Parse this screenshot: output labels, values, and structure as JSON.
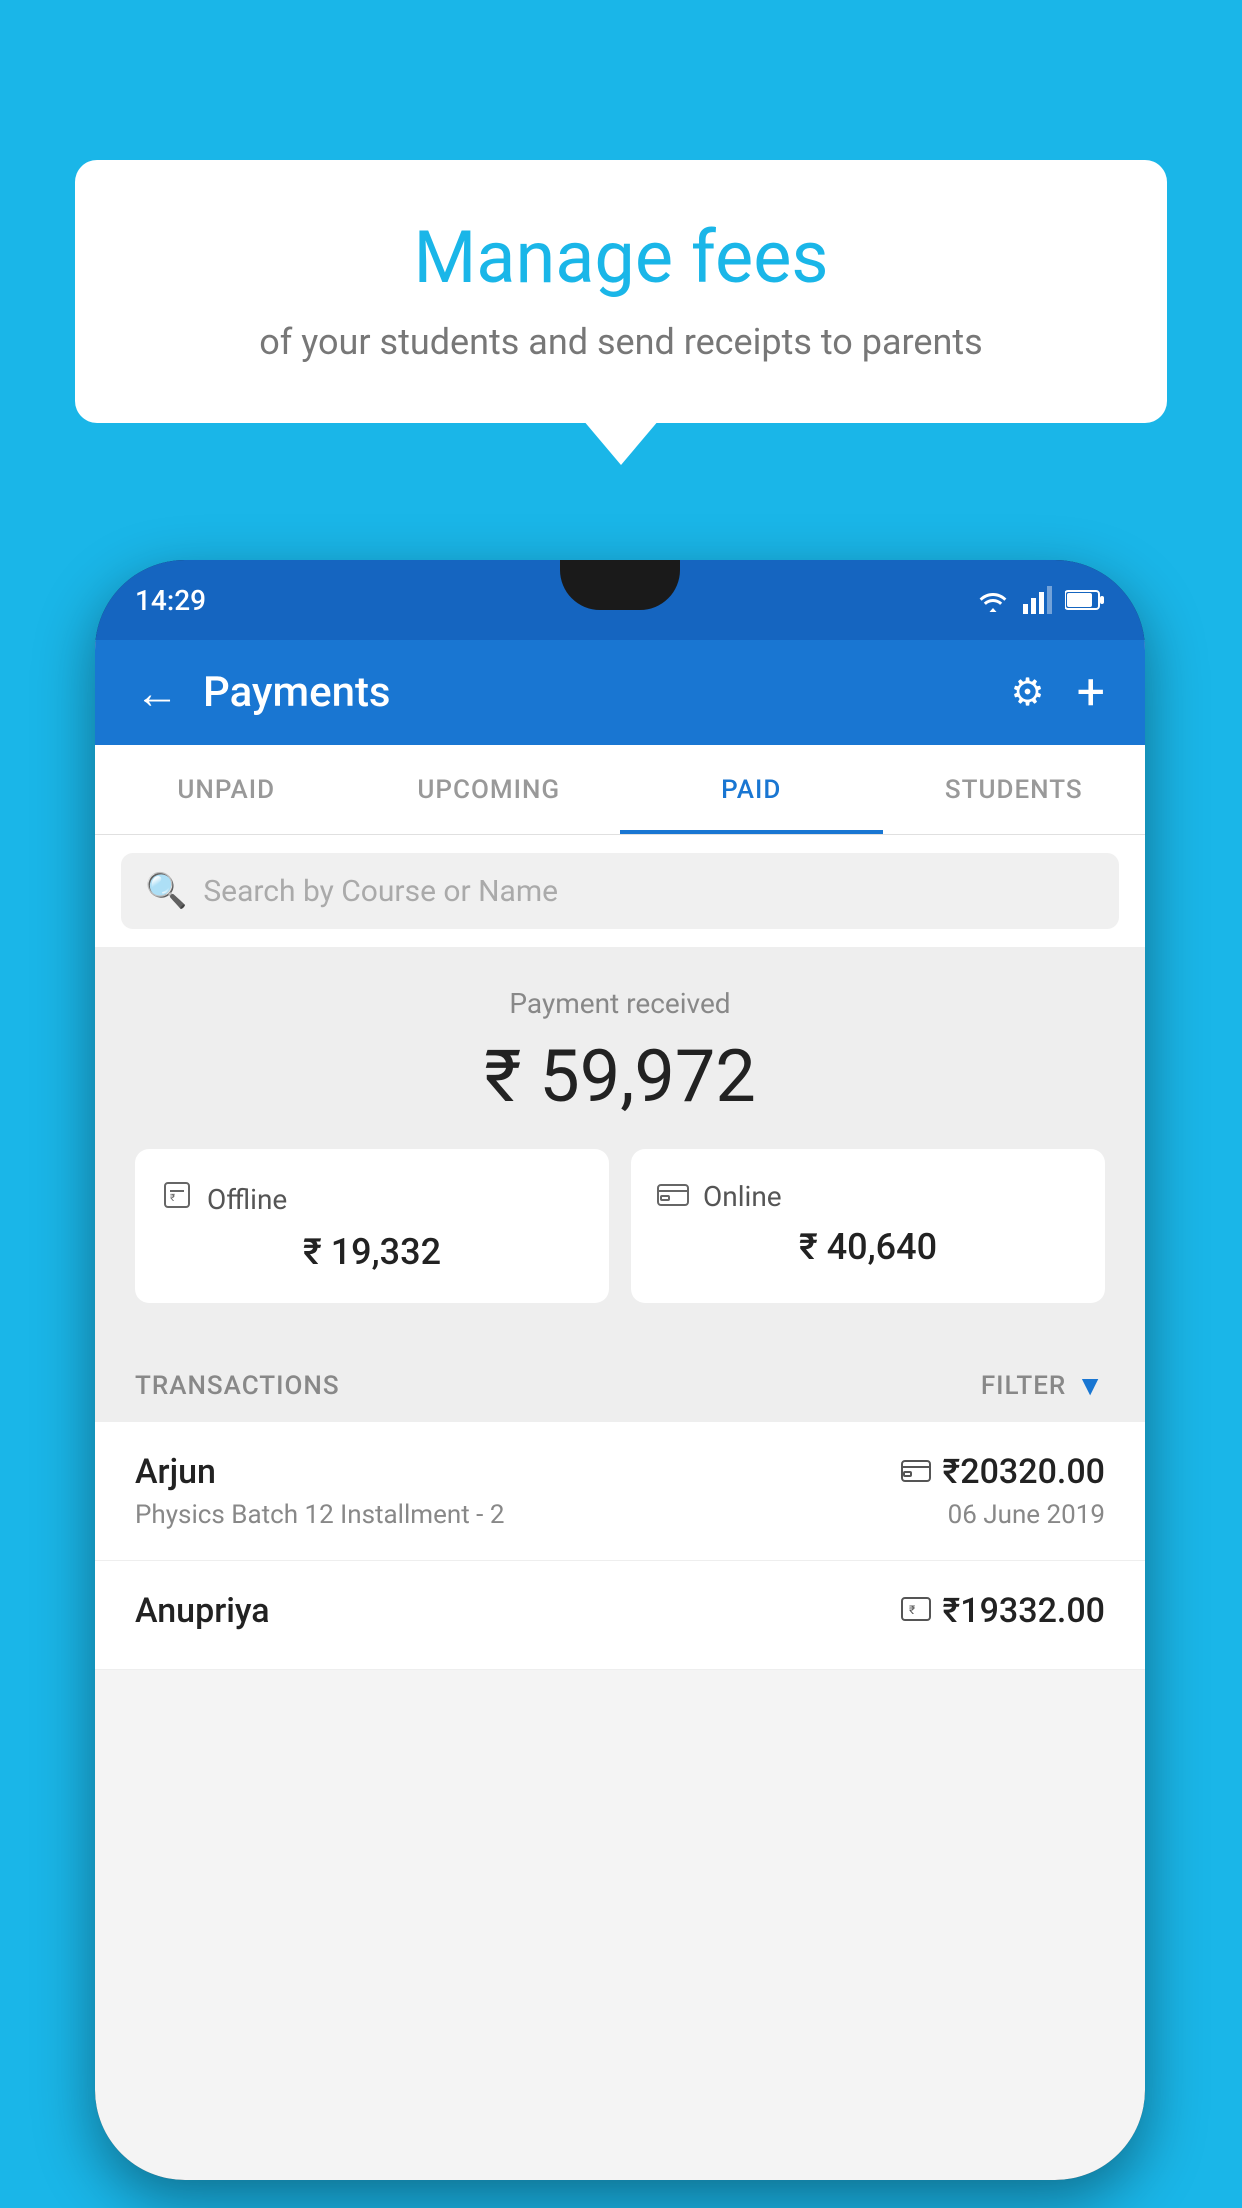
{
  "background_color": "#1ab6e8",
  "bubble": {
    "title": "Manage fees",
    "subtitle": "of your students and send receipts to parents"
  },
  "status_bar": {
    "time": "14:29"
  },
  "header": {
    "title": "Payments",
    "back_label": "←",
    "settings_label": "⚙",
    "add_label": "+"
  },
  "tabs": [
    {
      "label": "UNPAID",
      "active": false
    },
    {
      "label": "UPCOMING",
      "active": false
    },
    {
      "label": "PAID",
      "active": true
    },
    {
      "label": "STUDENTS",
      "active": false
    }
  ],
  "search": {
    "placeholder": "Search by Course or Name"
  },
  "payment_summary": {
    "label": "Payment received",
    "total": "₹ 59,972",
    "offline_label": "Offline",
    "offline_amount": "₹ 19,332",
    "online_label": "Online",
    "online_amount": "₹ 40,640"
  },
  "transactions": {
    "section_label": "TRANSACTIONS",
    "filter_label": "FILTER",
    "items": [
      {
        "name": "Arjun",
        "amount": "₹20320.00",
        "description": "Physics Batch 12 Installment - 2",
        "date": "06 June 2019",
        "payment_type": "online"
      },
      {
        "name": "Anupriya",
        "amount": "₹19332.00",
        "description": "",
        "date": "",
        "payment_type": "offline"
      }
    ]
  }
}
